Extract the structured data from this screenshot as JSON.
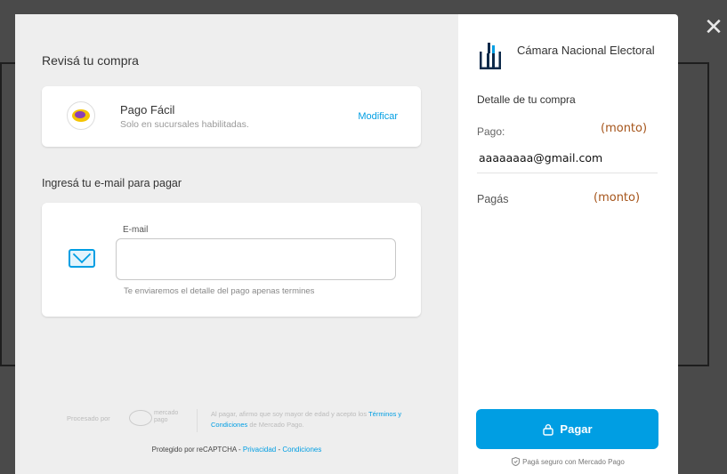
{
  "close_label": "✕",
  "left": {
    "review_title": "Revisá tu compra",
    "payment_method": {
      "name": "Pago Fácil",
      "subtitle": "Solo en sucursales habilitadas.",
      "modify_label": "Modificar"
    },
    "email_section_title": "Ingresá tu e-mail para pagar",
    "email_field": {
      "label": "E-mail",
      "value": "",
      "hint": "Te enviaremos el detalle del pago apenas termines"
    },
    "footer": {
      "processed_by": "Procesado por",
      "mp_logo_text": "mercado pago",
      "legal_prefix": "Al pagar, afirmo que soy mayor de edad y acepto los",
      "legal_link": "Términos y Condiciones",
      "legal_suffix": "de Mercado Pago.",
      "recaptcha_prefix": "Protegido por reCAPTCHA - ",
      "privacy_link": "Privacidad",
      "recaptcha_sep": " - ",
      "conditions_link": "Condiciones"
    }
  },
  "right": {
    "seller_name": "Cámara Nacional Electoral",
    "detail_title": "Detalle de tu compra",
    "pago_label": "Pago:",
    "pago_amount": "(monto)",
    "email": "aaaaaaaa@gmail.com",
    "pagas_label": "Pagás",
    "pagas_amount": "(monto)",
    "pay_button_label": "Pagar",
    "secure_note": "Pagá seguro con Mercado Pago"
  },
  "colors": {
    "accent": "#009ee3",
    "amount": "#a5541a"
  }
}
